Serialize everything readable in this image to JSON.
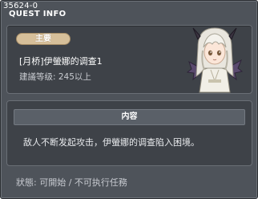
{
  "header": {
    "quest_id": "35624-0",
    "title": "QUEST INFO"
  },
  "quest": {
    "category_tag": "主要",
    "name": "[月桥]伊螢娜的调查1",
    "level_requirement": "建議等级: 245以上"
  },
  "content": {
    "header": "内容",
    "description": "敌人不断发起攻击，伊螢娜的调查陷入困境。"
  },
  "status": {
    "text": "狀態: 可開始 / 不可执行任務"
  },
  "npc": {
    "icon": "npc-portrait-white-haired-girl"
  },
  "colors": {
    "window_bg": "#4e535a",
    "panel_bg": "#3e4248",
    "tag_bg": "#d6bf9a",
    "header_bg": "#5a6068"
  }
}
